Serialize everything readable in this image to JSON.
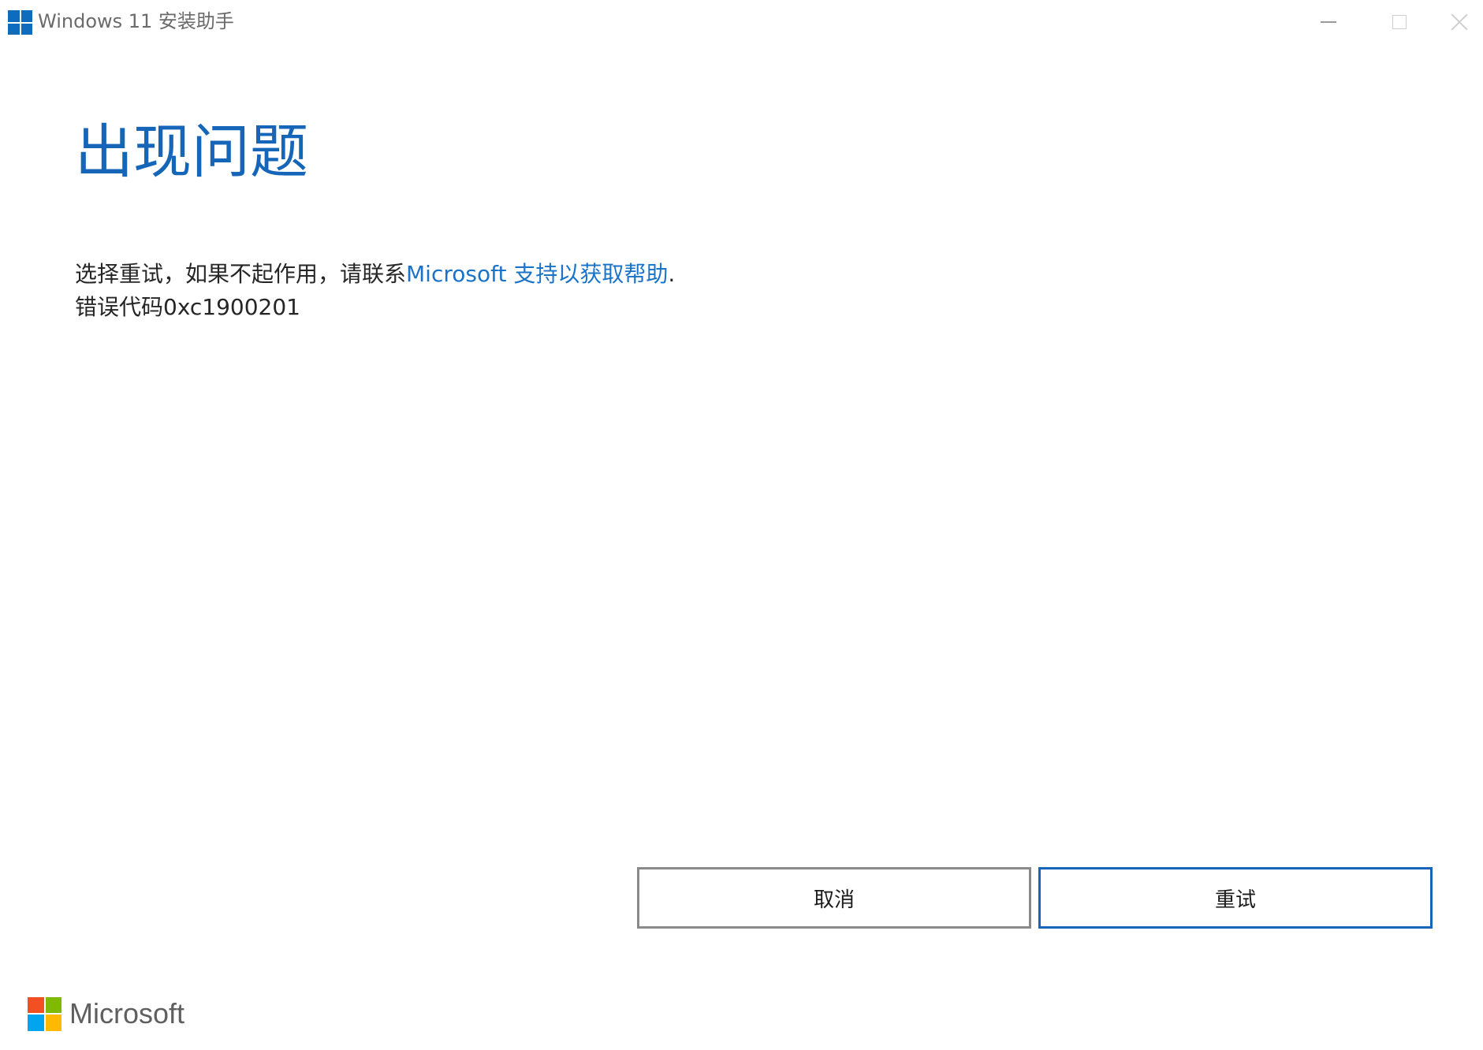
{
  "window": {
    "title": "Windows 11 安装助手",
    "app_icon": "windows-logo-icon",
    "accent_color": "#1565b8"
  },
  "controls": {
    "minimize_icon": "minimize-icon",
    "maximize_icon": "maximize-icon",
    "close_icon": "close-icon"
  },
  "main": {
    "heading": "出现问题",
    "message_prefix": "选择重试，如果不起作用，请联系",
    "support_link": "Microsoft 支持以获取帮助",
    "message_suffix": ".",
    "error_code": "错误代码0xc1900201"
  },
  "buttons": {
    "cancel_label": "取消",
    "retry_label": "重试"
  },
  "footer": {
    "brand_name": "Microsoft",
    "logo_colors": [
      "#f25022",
      "#7fba00",
      "#00a4ef",
      "#ffb900"
    ]
  }
}
